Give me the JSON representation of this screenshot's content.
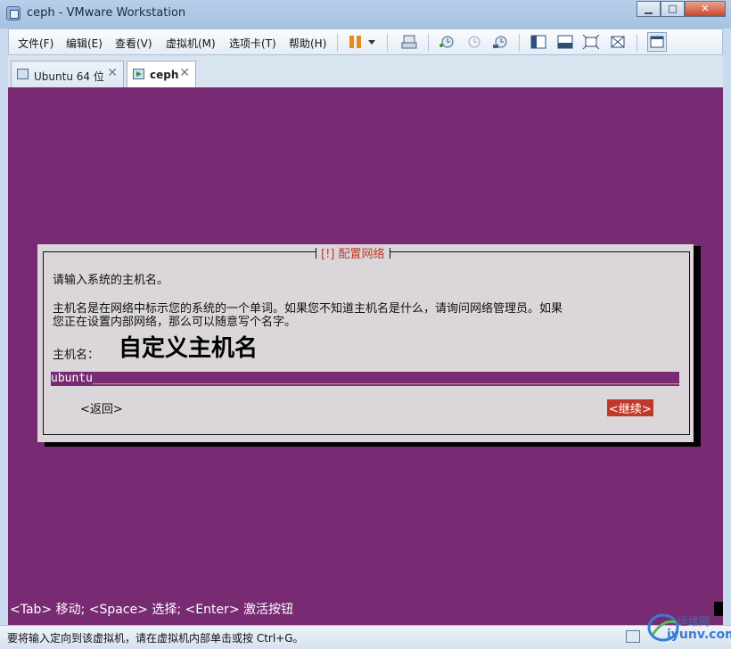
{
  "window": {
    "title": "ceph - VMware Workstation"
  },
  "menubar": {
    "items": [
      "文件(F)",
      "编辑(E)",
      "查看(V)",
      "虚拟机(M)",
      "选项卡(T)",
      "帮助(H)"
    ]
  },
  "toolbar": {
    "icons": [
      "pause-icon",
      "dropdown-arrow-icon",
      "send-keys-icon",
      "snapshot-take-icon",
      "snapshot-revert-icon",
      "snapshot-manager-icon",
      "sidebar-icon",
      "console-view-icon",
      "fullscreen-icon",
      "unity-icon",
      "library-icon"
    ]
  },
  "tabs": [
    {
      "label": "Ubuntu 64 位",
      "active": false
    },
    {
      "label": "ceph",
      "active": true
    }
  ],
  "installer": {
    "dialog_title": "[!] 配置网络",
    "prompt": "请输入系统的主机名。",
    "desc_line1": "主机名是在网络中标示您的系统的一个单词。如果您不知道主机名是什么，请询问网络管理员。如果",
    "desc_line2": "您正在设置内部网络，那么可以随意写个名字。",
    "hostname_label": "主机名：",
    "annotation": "自定义主机名",
    "hostname_value": "ubuntu________________________________________________________________________________________",
    "back_button": "<返回>",
    "continue_button": "<继续>",
    "key_hint": "<Tab> 移动; <Space> 选择; <Enter> 激活按钮"
  },
  "statusbar": {
    "text": "要将输入定向到该虚拟机，请在虚拟机内部单击或按 Ctrl+G。"
  },
  "watermark": {
    "line1": "运维网",
    "line2": "iyunv.com"
  },
  "colors": {
    "vm_background": "#782b73",
    "dialog": "#dad6da",
    "accent_red": "#c0392b"
  }
}
